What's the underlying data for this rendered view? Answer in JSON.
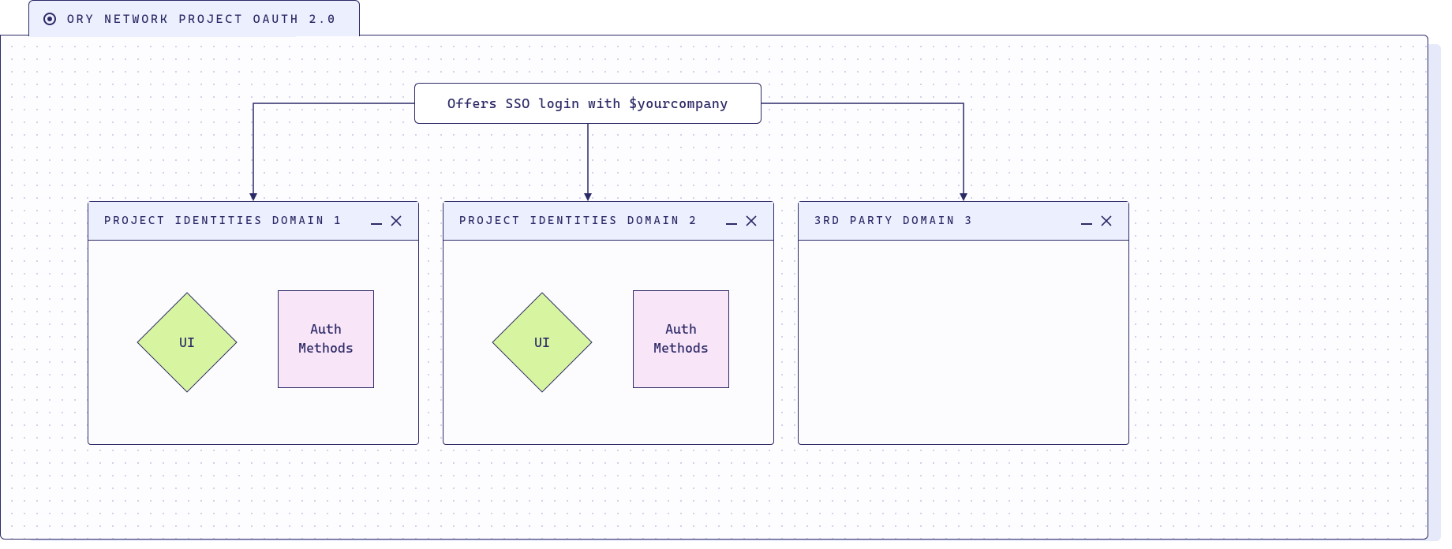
{
  "tab": {
    "label": "Ory Network Project OAuth 2.0"
  },
  "root": {
    "label": "Offers SSO login with $yourcompany"
  },
  "windows": [
    {
      "title": "Project Identities Domain 1",
      "ui": "UI",
      "auth": "Auth Methods"
    },
    {
      "title": "Project Identities Domain 2",
      "ui": "UI",
      "auth": "Auth Methods"
    },
    {
      "title": "3rd Party Domain 3"
    }
  ]
}
